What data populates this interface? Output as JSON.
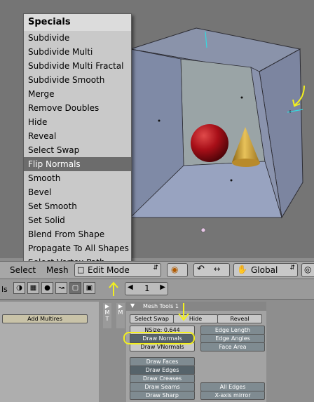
{
  "specials_menu": {
    "title": "Specials",
    "items": [
      "Subdivide",
      "Subdivide Multi",
      "Subdivide Multi Fractal",
      "Subdivide Smooth",
      "Merge",
      "Remove Doubles",
      "Hide",
      "Reveal",
      "Select Swap",
      "Flip Normals",
      "Smooth",
      "Bevel",
      "Set Smooth",
      "Set Solid",
      "Blend From Shape",
      "Propagate To All Shapes",
      "Select Vertex Path"
    ],
    "highlighted": "Flip Normals"
  },
  "header": {
    "select_label": "Select",
    "mesh_label": "Mesh",
    "mode_label": "Edit Mode",
    "orientation_label": "Global"
  },
  "buttons_header": {
    "frame_value": "1",
    "left_fragment": "ls"
  },
  "left_panel": {
    "add_multires": "Add Multires"
  },
  "mesh_tools": {
    "tab_title": "Mesh Tools 1",
    "select_swap": "Select Swap",
    "hide": "Hide",
    "reveal": "Reveal",
    "nsize": "NSize: 0.644",
    "draw_normals": "Draw Normals",
    "draw_vnormals": "Draw VNormals",
    "edge_length": "Edge Length",
    "edge_angles": "Edge Angles",
    "face_area": "Face Area",
    "draw_faces": "Draw Faces",
    "draw_edges": "Draw Edges",
    "draw_creases": "Draw Creases",
    "draw_seams": "Draw Seams",
    "draw_sharp": "Draw Sharp",
    "all_edges": "All Edges",
    "x_axis_mirror": "X-axis mirror"
  },
  "colors": {
    "annotation": "#f2ef1f",
    "sphere": "#b0121a",
    "cone": "#c99a2c",
    "cube_face": "#8993ad"
  }
}
